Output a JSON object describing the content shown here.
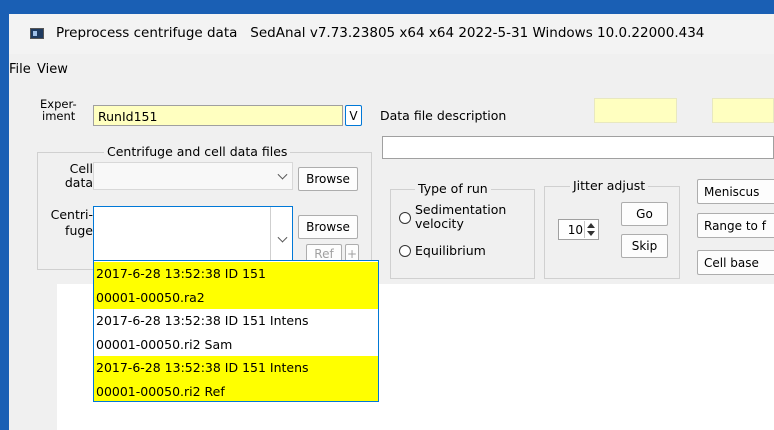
{
  "window": {
    "title": "Preprocess centrifuge data",
    "version_info": "SedAnal v7.73.23805 x64 x64 2022-5-31 Windows 10.0.22000.434"
  },
  "menu": [
    "File",
    "View"
  ],
  "experiment": {
    "label_line1": "Exper-",
    "label_line2": "iment",
    "value": "RunId151",
    "v_button": "V"
  },
  "data_file_description": {
    "label": "Data file description",
    "value": ""
  },
  "files_group": {
    "title": "Centrifuge and cell data files",
    "cell_label_line1": "Cell",
    "cell_label_line2": "data",
    "cell_value": "",
    "centrifuge_label_line1": "Centri-",
    "centrifuge_label_line2": "fuge",
    "centrifuge_value": "",
    "browse_cell": "Browse",
    "browse_centrifuge": "Browse",
    "ref_button": "Ref",
    "plus_button": "+"
  },
  "dropdown_options": [
    {
      "line1": "2017-6-28  13:52:38 ID 151",
      "line2": "00001-00050.ra2",
      "selected": true
    },
    {
      "line1": "2017-6-28  13:52:38 ID 151 Intens",
      "line2": "00001-00050.ri2  Sam",
      "selected": false
    },
    {
      "line1": "2017-6-28  13:52:38 ID 151 Intens",
      "line2": "00001-00050.ri2  Ref",
      "selected": true
    }
  ],
  "type_of_run": {
    "title": "Type of run",
    "options": [
      {
        "line1": "Sedimentation",
        "line2": "velocity"
      },
      {
        "line1": "Equilibrium",
        "line2": ""
      }
    ]
  },
  "jitter": {
    "title": "Jitter adjust",
    "value": "10",
    "go": "Go",
    "skip": "Skip"
  },
  "right_buttons": [
    "Meniscus",
    "Range to f",
    "Cell base"
  ],
  "colors": {
    "highlight": "#ffff00",
    "input_yellow": "#ffffc0",
    "focus_blue": "#0078d7",
    "desktop": "#1a5fb4"
  }
}
